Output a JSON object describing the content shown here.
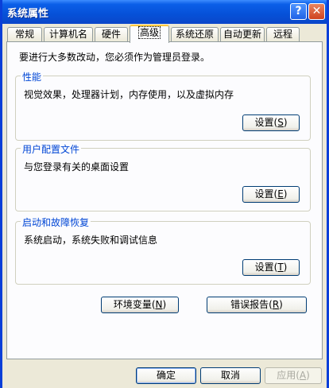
{
  "window": {
    "title": "系统属性",
    "help_glyph": "?",
    "close_glyph": "✕"
  },
  "tabs": [
    {
      "label": "常规"
    },
    {
      "label": "计算机名"
    },
    {
      "label": "硬件"
    },
    {
      "label": "高级",
      "active": true
    },
    {
      "label": "系统还原"
    },
    {
      "label": "自动更新"
    },
    {
      "label": "远程"
    }
  ],
  "panel": {
    "intro": "要进行大多数改动，您必须作为管理员登录。",
    "performance": {
      "legend": "性能",
      "desc": "视觉效果，处理器计划，内存使用，以及虚拟内存",
      "button": "设置",
      "key": "S"
    },
    "profiles": {
      "legend": "用户配置文件",
      "desc": "与您登录有关的桌面设置",
      "button": "设置",
      "key": "E"
    },
    "startup": {
      "legend": "启动和故障恢复",
      "desc": "系统启动，系统失败和调试信息",
      "button": "设置",
      "key": "T"
    },
    "env_button": "环境变量",
    "env_key": "N",
    "error_button": "错误报告",
    "error_key": "R"
  },
  "footer": {
    "ok": "确定",
    "cancel": "取消",
    "apply": "应用",
    "apply_key": "A"
  },
  "colors": {
    "titlebar": "#0651d8",
    "group_legend": "#0046d5",
    "active_tab_accent": "#ffc83c"
  }
}
